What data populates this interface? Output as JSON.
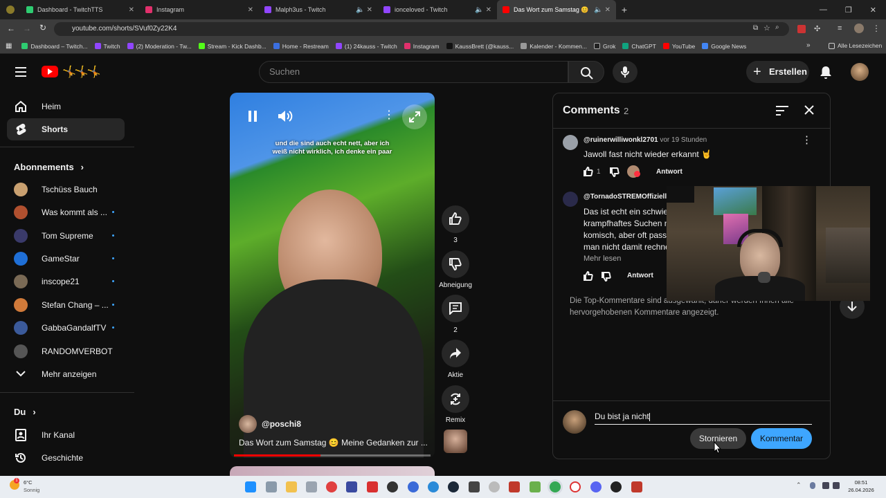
{
  "browser": {
    "tabs": [
      {
        "title": "Dashboard - TwitchTTS",
        "color": "#2ecc71"
      },
      {
        "title": "Instagram",
        "color": "#e1306c"
      },
      {
        "title": "Malph3us - Twitch",
        "color": "#9146ff"
      },
      {
        "title": "ionceloved - Twitch",
        "color": "#9146ff"
      },
      {
        "title": "Das Wort zum Samstag 😊",
        "color": "#ff0000"
      }
    ],
    "url": "youtube.com/shorts/SVuf0Zy22K4",
    "bookmarks": [
      "Dashboard – Twitch...",
      "Twitch",
      "(2) Moderation - Tw...",
      "Stream - Kick Dashb...",
      "Home - Restream",
      "(1) 24kauss - Twitch",
      "Instagram",
      "KaussBrett (@kauss...",
      "Kalender - Kommen...",
      "Grok",
      "ChatGPT",
      "YouTube",
      "Google News"
    ],
    "all_bookmarks": "Alle Lesezeichen"
  },
  "header": {
    "search_placeholder": "Suchen",
    "create_label": "Erstellen"
  },
  "sidebar": {
    "home": "Heim",
    "shorts": "Shorts",
    "subscriptions_title": "Abonnements",
    "subs": [
      {
        "name": "Tschüss Bauch",
        "color": "#c9a070",
        "dot": false
      },
      {
        "name": "Was kommt als ...",
        "color": "#b0502f",
        "dot": true
      },
      {
        "name": "Tom Supreme",
        "color": "#3a3a6a",
        "dot": true
      },
      {
        "name": "GameStar",
        "color": "#1f6fd6",
        "dot": true
      },
      {
        "name": "inscope21",
        "color": "#7a6a55",
        "dot": true
      },
      {
        "name": "Stefan Chang – ...",
        "color": "#d07a3a",
        "dot": true
      },
      {
        "name": "GabbaGandalfTV",
        "color": "#3b5a9a",
        "dot": true
      },
      {
        "name": "RANDOMVERBOT",
        "color": "#555555",
        "dot": false
      }
    ],
    "more": "Mehr anzeigen",
    "you_title": "Du",
    "channel": "Ihr Kanal",
    "history": "Geschichte"
  },
  "video": {
    "caption": "und die sind auch echt nett, aber ich weiß nicht wirklich, ich denke ein paar",
    "channel": "@poschi8",
    "title": "Das Wort zum Samstag 😊 Meine Gedanken zur ...",
    "likes": "3",
    "dislike_label": "Abneigung",
    "comments_count": "2",
    "share_label": "Aktie",
    "remix_label": "Remix"
  },
  "comments": {
    "title": "Comments",
    "count": "2",
    "items": [
      {
        "author": "@ruinerwilliwonkl2701",
        "time": "vor 19 Stunden",
        "text": "Jawoll fast nicht wieder erkannt 🤘",
        "likes": "1",
        "reply": "Antwort"
      },
      {
        "author": "@TornadoSTREMOffiziell",
        "lines": [
          "Das ist echt ein schwier",
          "krampfhaftes Suchen n",
          "komisch, aber oft passi",
          "man nicht damit rechne"
        ],
        "more": "Mehr lesen",
        "reply": "Antwort"
      }
    ],
    "notice": "Die Top-Kommentare sind ausgewählt, daher werden Ihnen alle hervorgehobenen Kommentare angezeigt.",
    "input_value": "Du bist ja nicht",
    "cancel_label": "Stornieren",
    "submit_label": "Kommentar"
  },
  "taskbar": {
    "weather_temp": "6°C",
    "weather_desc": "Sonnig",
    "time": "08:51",
    "date": "26.04.2026"
  }
}
